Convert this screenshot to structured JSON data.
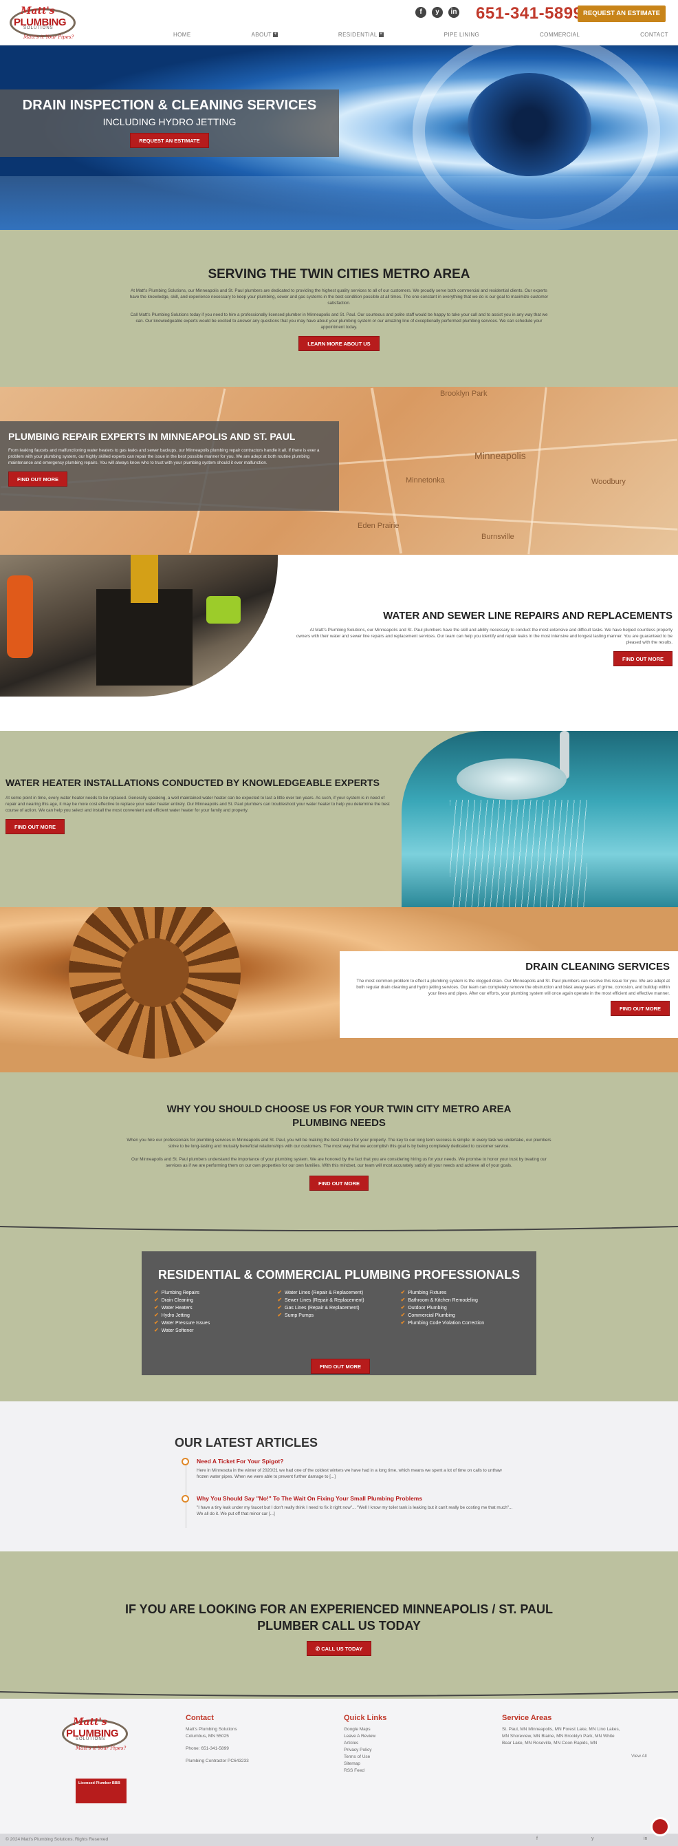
{
  "header": {
    "logo": {
      "line1": "Matt's",
      "line2": "PLUMBING",
      "line3": "SOLUTIONS",
      "tagline": "Matt's it Your Pipes?"
    },
    "social": [
      {
        "name": "facebook-icon",
        "glyph": "f"
      },
      {
        "name": "yelp-icon",
        "glyph": "y"
      },
      {
        "name": "linkedin-icon",
        "glyph": "in"
      }
    ],
    "phone": "651-341-5899",
    "request_button": "REQUEST AN ESTIMATE",
    "nav": [
      "HOME",
      "ABOUT",
      "RESIDENTIAL",
      "PIPE LINING",
      "COMMERCIAL",
      "CONTACT"
    ]
  },
  "hero": {
    "title": "DRAIN INSPECTION & CLEANING SERVICES",
    "subtitle": "INCLUDING HYDRO JETTING",
    "button": "REQUEST AN ESTIMATE"
  },
  "serving": {
    "title": "SERVING THE TWIN CITIES METRO AREA",
    "p1": "At Matt's Plumbing Solutions, our Minneapolis and St. Paul plumbers are dedicated to providing the highest quality services to all of our customers. We proudly serve both commercial and residential clients. Our experts have the knowledge, skill, and experience necessary to keep your plumbing, sewer and gas systems in the best condition possible at all times. The one constant in everything that we do is our goal to maximize customer satisfaction.",
    "p2": "Call Matt's Plumbing Solutions today if you need to hire a professionally licensed plumber in Minneapolis and St. Paul. Our courteous and polite staff would be happy to take your call and to assist you in any way that we can. Our knowledgeable experts would be excited to answer any questions that you may have about your plumbing system or our amazing line of exceptionally performed plumbing services. We can schedule your appointment today.",
    "button": "LEARN MORE ABOUT US"
  },
  "repair": {
    "title": "PLUMBING REPAIR EXPERTS IN MINNEAPOLIS AND ST. PAUL",
    "text": "From leaking faucets and malfunctioning water heaters to gas leaks and sewer backups, our Minneapolis plumbing repair contractors handle it all. If there is ever a problem with your plumbing system, our highly skilled experts can repair the issue in the best possible manner for you. We are adept at both routine plumbing maintenance and emergency plumbing repairs. You will always know who to trust with your plumbing system should it ever malfunction.",
    "button": "FIND OUT MORE",
    "map_labels": [
      "Brooklyn Park",
      "Minneapolis",
      "Minnetonka",
      "Woodbury",
      "Eden Prairie",
      "Burnsville"
    ]
  },
  "sewer": {
    "title": "WATER AND SEWER LINE REPAIRS AND REPLACEMENTS",
    "text": "At Matt's Plumbing Solutions, our Minneapolis and St. Paul plumbers have the skill and ability necessary to conduct the most extensive and difficult tasks. We have helped countless property owners with their water and sewer line repairs and replacement services. Our team can help you identify and repair leaks in the most intensive and longest lasting manner. You are guaranteed to be pleased with the results.",
    "button": "FIND OUT MORE"
  },
  "heater": {
    "title": "WATER HEATER INSTALLATIONS CONDUCTED BY KNOWLEDGEABLE EXPERTS",
    "text": "At some point in time, every water heater needs to be replaced. Generally speaking, a well maintained water heater can be expected to last a little over ten years. As such, if your system is in need of repair and nearing this age, it may be more cost effective to replace your water heater entirely. Our Minneapolis and St. Paul plumbers can troubleshoot your water heater to help you determine the best course of action. We can help you select and install the most convenient and efficient water heater for your family and property.",
    "button": "FIND OUT MORE"
  },
  "drain": {
    "title": "DRAIN CLEANING SERVICES",
    "text": "The most common problem to effect a plumbing system is the clogged drain. Our Minneapolis and St. Paul plumbers can resolve this issue for you. We are adept at both regular drain cleaning and hydro jetting services. Our team can completely remove the obstruction and blast away years of grime, corrosion, and buildup within your lines and pipes. After our efforts, your plumbing system will once again operate in the most efficient and effective manner.",
    "button": "FIND OUT MORE"
  },
  "why": {
    "title": "WHY YOU SHOULD CHOOSE US FOR YOUR TWIN CITY METRO AREA PLUMBING NEEDS",
    "p1": "When you hire our professionals for plumbing services in Minneapolis and St. Paul, you will be making the best choice for your property. The key to our long term success is simple: in every task we undertake, our plumbers strive to be long-lasting and mutually beneficial relationships with our customers. The most way that we accomplish this goal is by being completely dedicated to customer service.",
    "p2": "Our Minneapolis and St. Paul plumbers understand the importance of your plumbing system. We are honored by the fact that you are considering hiring us for your needs. We promise to honor your trust by treating our services as if we are performing them on our own properties for our own families. With this mindset, our team will most accurately satisfy all your needs and achieve all of your goals.",
    "button": "FIND OUT MORE"
  },
  "residential": {
    "title": "RESIDENTIAL & COMMERCIAL PLUMBING PROFESSIONALS",
    "col1": [
      "Plumbing Repairs",
      "Drain Cleaning",
      "Water Heaters",
      "Hydro Jetting",
      "Water Pressure Issues",
      "Water Softener"
    ],
    "col2": [
      "Water Lines (Repair & Replacement)",
      "Sewer Lines (Repair & Replacement)",
      "Gas Lines (Repair & Replacement)",
      "Sump Pumps"
    ],
    "col3": [
      "Plumbing Fixtures",
      "Bathroom & Kitchen Remodeling",
      "Outdoor Plumbing",
      "Commercial Plumbing",
      "Plumbing Code Violation Correction"
    ],
    "button": "FIND OUT MORE"
  },
  "articles": {
    "title": "OUR LATEST ARTICLES",
    "items": [
      {
        "title": "Need A Ticket For Your Spigot?",
        "excerpt": "Here in Minnesota in the winter of 2020/21 we had one of the coldest winters we have had in a long time, which means we spent a lot of time on calls to unthaw frozen water pipes. When we were able to prevent further damage to [...]"
      },
      {
        "title": "Why You Should Say \"No!\" To The Wait On Fixing Your Small Plumbing Problems",
        "excerpt": "\"I have a tiny leak under my faucet but I don't really think I need to fix it right now\"... \"Well I know my toilet tank is leaking but it can't really be costing me that much\"... We all do it. We put off that minor car [...]"
      }
    ]
  },
  "cta": {
    "title": "IF YOU ARE LOOKING FOR AN EXPERIENCED MINNEAPOLIS / ST. PAUL PLUMBER CALL US TODAY",
    "button": "CALL US TODAY"
  },
  "footer": {
    "badge": "Licensed Plumber BBB",
    "contact": {
      "title": "Contact",
      "name": "Matt's Plumbing Solutions",
      "city": "Columbus, MN 55025",
      "phone": "Phone: 651-341-5899",
      "license": "Plumbing Contractor PC643233"
    },
    "links": {
      "title": "Quick Links",
      "items": [
        "Google Maps",
        "Leave A Review",
        "Articles",
        "Privacy Policy",
        "Terms of Use",
        "Sitemap",
        "RSS Feed"
      ]
    },
    "areas": {
      "title": "Service Areas",
      "line1": "St. Paul, MN   Minneapolis, MN   Forest Lake, MN   Lino Lakes,",
      "line2": "MN   Shoreview, MN   Blaine, MN   Brooklyn Park, MN   White",
      "line3": "Bear Lake, MN   Roseville, MN   Coon Rapids, MN",
      "view_all": "View All"
    },
    "copyright": "© 2024 Matt's Plumbing Solutions. Rights Reserved",
    "bottom_social": [
      "f",
      "y",
      "in"
    ]
  },
  "colors": {
    "brand_red": "#b71c1c",
    "accent_orange": "#c88419",
    "olive": "#bcc19f"
  }
}
